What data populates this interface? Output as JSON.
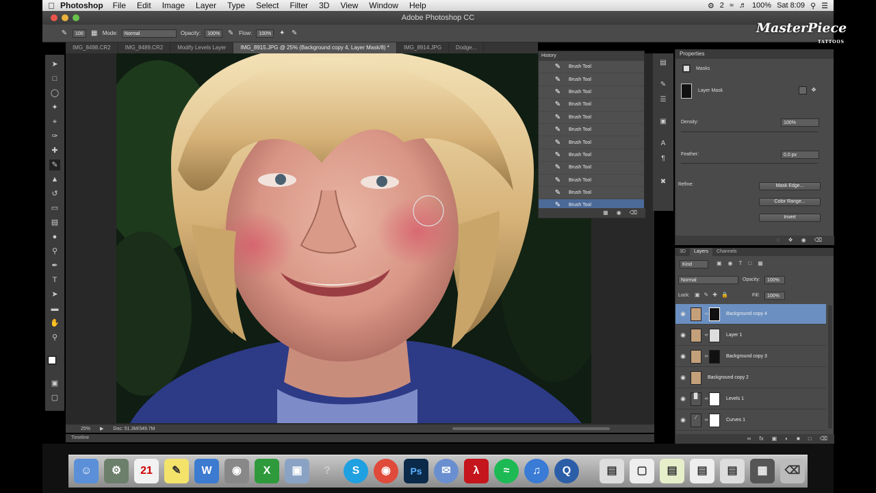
{
  "menubar": {
    "app_name": "Photoshop",
    "items": [
      "File",
      "Edit",
      "Image",
      "Layer",
      "Type",
      "Select",
      "Filter",
      "3D",
      "View",
      "Window",
      "Help"
    ],
    "status": {
      "badge": "2",
      "battery": "100%",
      "clock": "Sat 8:09"
    }
  },
  "window": {
    "title": "Adobe Photoshop CC"
  },
  "options_bar": {
    "brush_size": "100",
    "mode_label": "Mode:",
    "mode_value": "Normal",
    "opacity_label": "Opacity:",
    "opacity_value": "100%",
    "flow_label": "Flow:",
    "flow_value": "100%"
  },
  "doc_tabs": [
    {
      "label": "IMG_8498.CR2"
    },
    {
      "label": "IMG_8489.CR2"
    },
    {
      "label": "Modify Levels Layer"
    },
    {
      "label": "IMG_8915.JPG @ 25% (Background copy 4, Layer Mask/8) *"
    },
    {
      "label": "IMG_8914.JPG"
    },
    {
      "label": "Dodge..."
    }
  ],
  "history": {
    "title": "History",
    "items": [
      "Brush Tool",
      "Brush Tool",
      "Brush Tool",
      "Brush Tool",
      "Brush Tool",
      "Brush Tool",
      "Brush Tool",
      "Brush Tool",
      "Brush Tool",
      "Brush Tool",
      "Brush Tool",
      "Brush Tool"
    ],
    "selected_index": 11
  },
  "properties": {
    "title": "Properties",
    "section": "Masks",
    "mask_type": "Layer Mask",
    "density_label": "Density:",
    "density_value": "100%",
    "feather_label": "Feather:",
    "feather_value": "0.0 px",
    "refine_label": "Refine:",
    "btn_mask_edge": "Mask Edge...",
    "btn_color_range": "Color Range...",
    "btn_invert": "Invert"
  },
  "layers_panel": {
    "tab_3d": "3D",
    "tab_layers": "Layers",
    "tab_channels": "Channels",
    "kind_label": "Kind",
    "blend_mode": "Normal",
    "opacity_label": "Opacity:",
    "opacity_value": "100%",
    "lock_label": "Lock:",
    "fill_label": "Fill:",
    "fill_value": "100%",
    "layers": [
      {
        "name": "Background copy 4",
        "selected": true
      },
      {
        "name": "Layer 1",
        "selected": false
      },
      {
        "name": "Background copy 3",
        "selected": false
      },
      {
        "name": "Background copy 2",
        "selected": false
      },
      {
        "name": "Levels 1",
        "selected": false
      },
      {
        "name": "Curves 1",
        "selected": false
      }
    ]
  },
  "status_bar": {
    "zoom": "25%",
    "doc_info": "Doc: 51.3M/349.7M"
  },
  "timeline": {
    "label": "Timeline"
  },
  "dock": {
    "calendar_day": "21"
  },
  "watermark": {
    "brand": "MasterPiece",
    "sub": "TATTOOS"
  }
}
